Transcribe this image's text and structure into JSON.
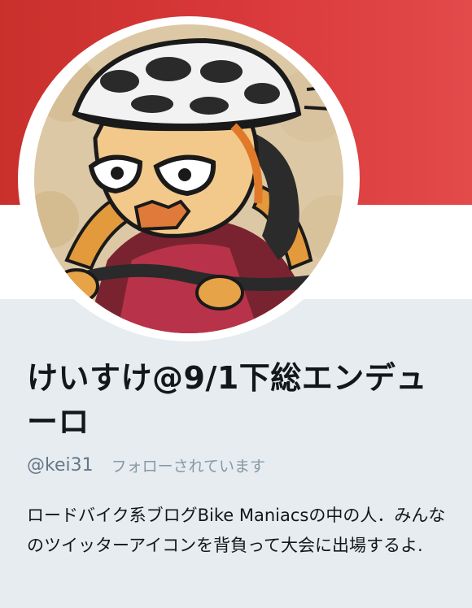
{
  "profile": {
    "display_name": "けいすけ@9/1下総エンデューロ",
    "screen_name": "@kei31",
    "follows_you": "フォローされています",
    "bio": "ロードバイク系ブログBike Maniacsの中の人．みんなのツイッターアイコンを背負って大会に出場するよ."
  },
  "avatar": {
    "icon": "cyclist-caricature-icon"
  },
  "colors": {
    "banner": "#d9383a",
    "background": "#e6ecf0",
    "text": "#14171a",
    "muted": "#657786"
  }
}
